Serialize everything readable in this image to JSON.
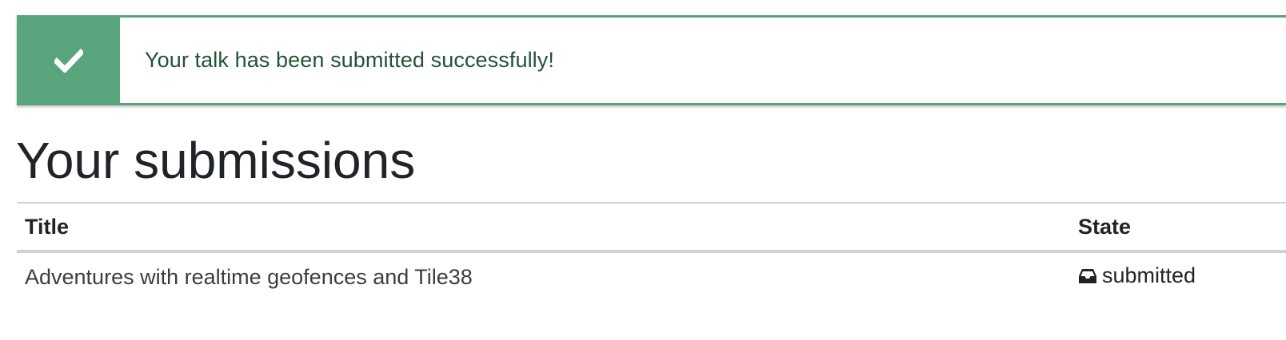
{
  "alert": {
    "icon": "checkmark-icon",
    "message": "Your talk has been submitted successfully!",
    "accent_color": "#5aa47d",
    "text_color": "#235236"
  },
  "page": {
    "heading": "Your submissions"
  },
  "table": {
    "columns": [
      "Title",
      "State"
    ],
    "rows": [
      {
        "title": "Adventures with realtime geofences and Tile38",
        "state": "submitted",
        "state_icon": "inbox-icon"
      }
    ]
  }
}
